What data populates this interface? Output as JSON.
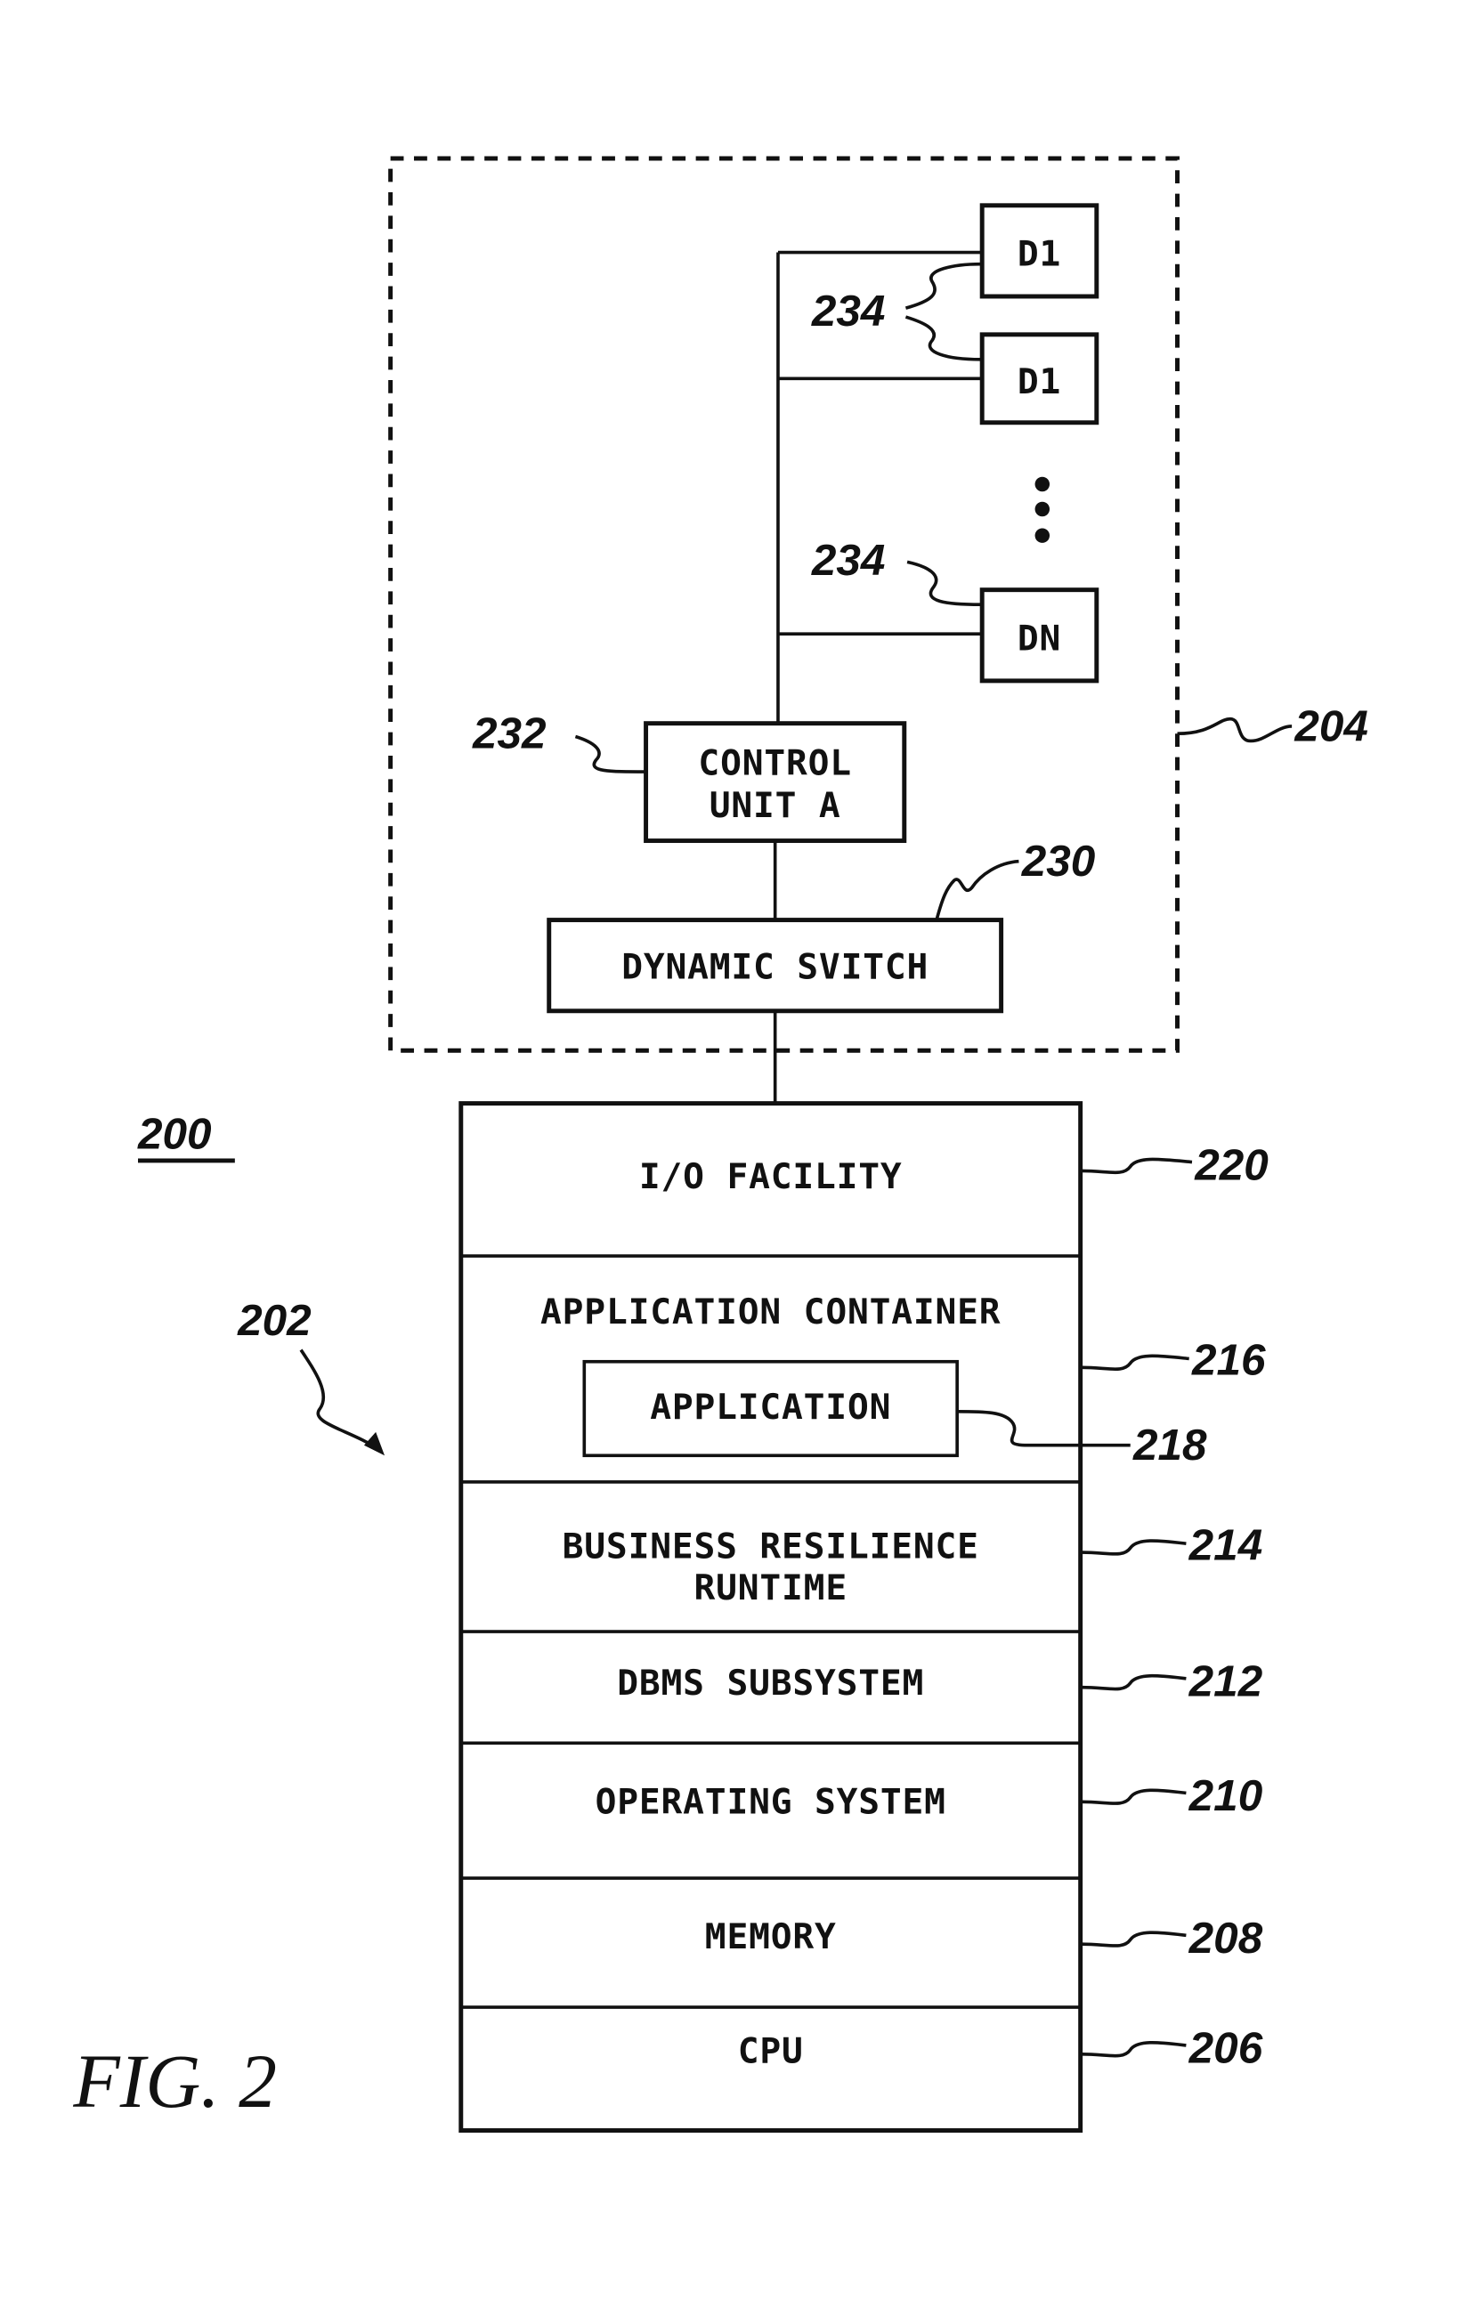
{
  "figure": {
    "caption": "FIG. 2",
    "system_ref": "200",
    "arrow_ref": "202"
  },
  "storage_subsystem": {
    "ref": "204",
    "devices": [
      {
        "label": "D1",
        "ref": "234"
      },
      {
        "label": "D1",
        "ref": ""
      },
      {
        "label": "DN",
        "ref": "234"
      }
    ],
    "ellipsis": "⋮",
    "control_unit": {
      "label_line1": "CONTROL",
      "label_line2": "UNIT A",
      "ref": "232"
    },
    "dynamic_switch": {
      "label": "DYNAMIC SVITCH",
      "ref": "230"
    }
  },
  "stack": {
    "ref": "202",
    "layers": [
      {
        "label": "I/O FACILITY",
        "ref": "220"
      },
      {
        "label": "APPLICATION CONTAINER",
        "ref": "216",
        "inner": {
          "label": "APPLICATION",
          "ref": "218"
        }
      },
      {
        "label_line1": "BUSINESS RESILIENCE",
        "label_line2": "RUNTIME",
        "ref": "214"
      },
      {
        "label": "DBMS SUBSYSTEM",
        "ref": "212"
      },
      {
        "label": "OPERATING SYSTEM",
        "ref": "210"
      },
      {
        "label": "MEMORY",
        "ref": "208"
      },
      {
        "label": "CPU",
        "ref": "206"
      }
    ]
  }
}
